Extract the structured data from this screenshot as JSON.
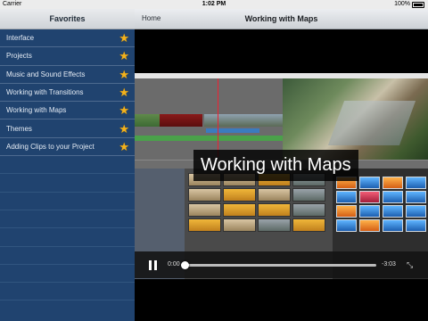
{
  "status_bar": {
    "carrier": "Carrier",
    "time": "1:02 PM",
    "battery": "100%"
  },
  "sidebar": {
    "title": "Favorites",
    "items": [
      {
        "label": "Interface"
      },
      {
        "label": "Projects"
      },
      {
        "label": "Music and Sound Effects"
      },
      {
        "label": "Working with Transitions"
      },
      {
        "label": "Working with Maps"
      },
      {
        "label": "Themes"
      },
      {
        "label": "Adding Clips to your Project"
      }
    ],
    "star_color": "#f3b21d"
  },
  "navbar": {
    "back_label": "Home",
    "title": "Working with Maps"
  },
  "video": {
    "caption": "Working with Maps",
    "elapsed": "0:00",
    "remaining": "-3:03",
    "progress_fraction": 0.0
  }
}
